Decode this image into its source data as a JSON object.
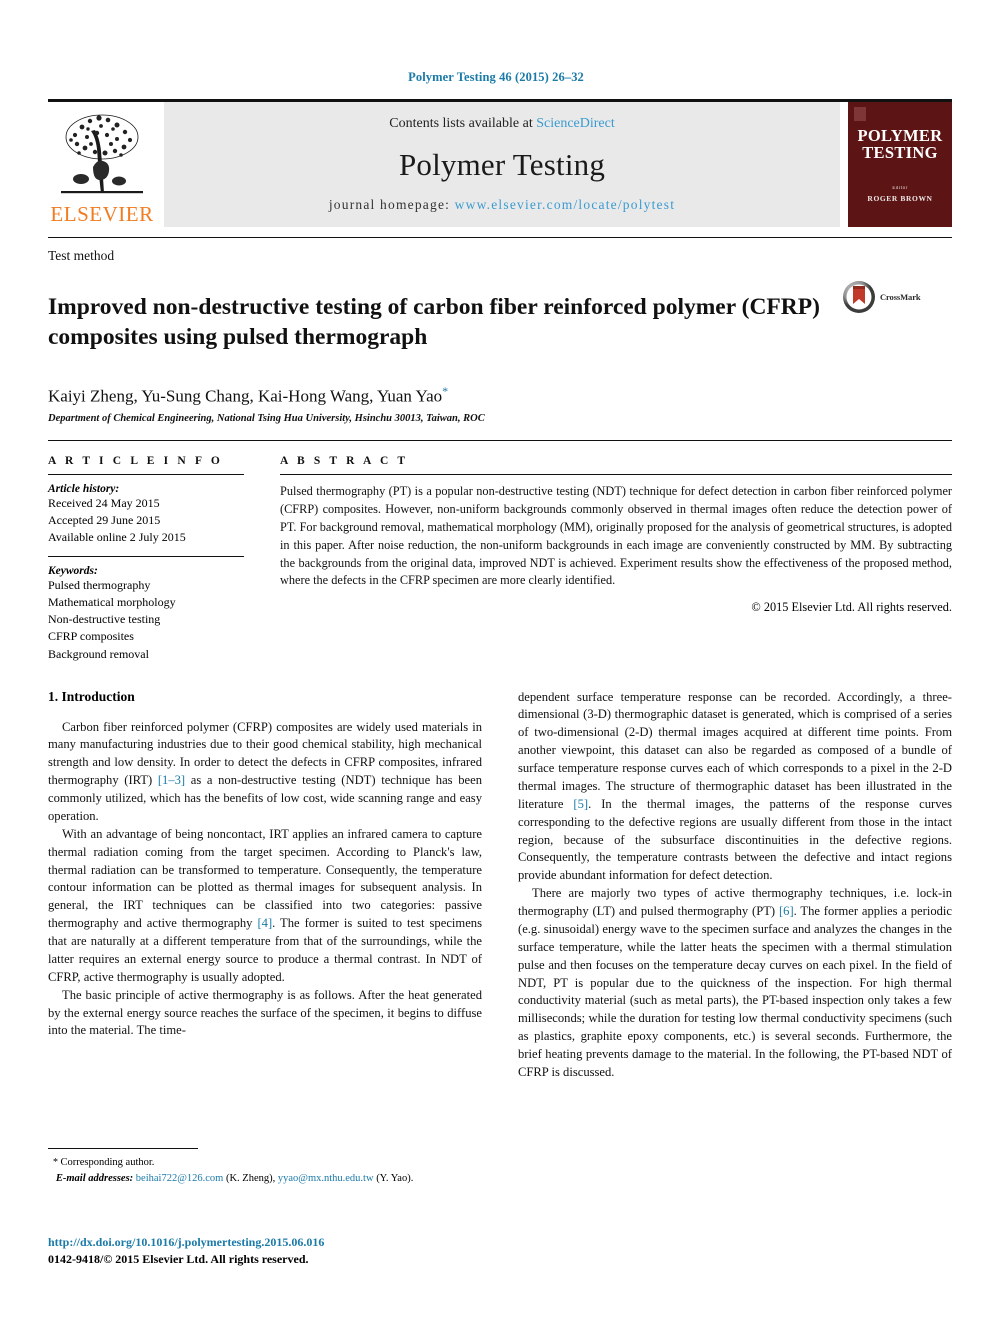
{
  "running_head": "Polymer Testing 46 (2015) 26–32",
  "masthead": {
    "publisher_logo_text": "ELSEVIER",
    "contents_prefix": "Contents lists available at ",
    "contents_link": "ScienceDirect",
    "journal_title": "Polymer Testing",
    "homepage_prefix": "journal homepage: ",
    "homepage_url": "www.elsevier.com/locate/polytest",
    "cover": {
      "title_line1": "POLYMER",
      "title_line2": "TESTING",
      "editor_label": "Editor",
      "editor_name": "ROGER BROWN"
    }
  },
  "article": {
    "section_kind": "Test method",
    "title": "Improved non-destructive testing of carbon fiber reinforced polymer (CFRP) composites using pulsed thermograph",
    "crossmark_label": "CrossMark",
    "authors": "Kaiyi Zheng, Yu-Sung Chang, Kai-Hong Wang, Yuan Yao",
    "corresponding_marker": "*",
    "affiliation": "Department of Chemical Engineering, National Tsing Hua University, Hsinchu 30013, Taiwan, ROC"
  },
  "article_info": {
    "label": "A R T I C L E   I N F O",
    "history_heading": "Article history:",
    "history": [
      "Received 24 May 2015",
      "Accepted 29 June 2015",
      "Available online 2 July 2015"
    ],
    "keywords_heading": "Keywords:",
    "keywords": [
      "Pulsed thermography",
      "Mathematical morphology",
      "Non-destructive testing",
      "CFRP composites",
      "Background removal"
    ]
  },
  "abstract": {
    "label": "A B S T R A C T",
    "text": "Pulsed thermography (PT) is a popular non-destructive testing (NDT) technique for defect detection in carbon fiber reinforced polymer (CFRP) composites. However, non-uniform backgrounds commonly observed in thermal images often reduce the detection power of PT. For background removal, mathematical morphology (MM), originally proposed for the analysis of geometrical structures, is adopted in this paper. After noise reduction, the non-uniform backgrounds in each image are conveniently constructed by MM. By subtracting the backgrounds from the original data, improved NDT is achieved. Experiment results show the effectiveness of the proposed method, where the defects in the CFRP specimen are more clearly identified.",
    "copyright": "© 2015 Elsevier Ltd. All rights reserved."
  },
  "body": {
    "heading": "1. Introduction",
    "left_p1_a": "Carbon fiber reinforced polymer (CFRP) composites are widely used materials in many manufacturing industries due to their good chemical stability, high mechanical strength and low density. In order to detect the defects in CFRP composites, infrared thermography (IRT) ",
    "left_p1_ref": "[1–3]",
    "left_p1_b": " as a non-destructive testing (NDT) technique has been commonly utilized, which has the benefits of low cost, wide scanning range and easy operation.",
    "left_p2_a": "With an advantage of being noncontact, IRT applies an infrared camera to capture thermal radiation coming from the target specimen. According to Planck's law, thermal radiation can be transformed to temperature. Consequently, the temperature contour information can be plotted as thermal images for subsequent analysis. In general, the IRT techniques can be classified into two categories: passive thermography and active thermography ",
    "left_p2_ref": "[4]",
    "left_p2_b": ". The former is suited to test specimens that are naturally at a different temperature from that of the surroundings, while the latter requires an external energy source to produce a thermal contrast. In NDT of CFRP, active thermography is usually adopted.",
    "left_p3": "The basic principle of active thermography is as follows. After the heat generated by the external energy source reaches the surface of the specimen, it begins to diffuse into the material. The time-",
    "right_p1_a": "dependent surface temperature response can be recorded. Accordingly, a three-dimensional (3-D) thermographic dataset is generated, which is comprised of a series of two-dimensional (2-D) thermal images acquired at different time points. From another viewpoint, this dataset can also be regarded as composed of a bundle of surface temperature response curves each of which corresponds to a pixel in the 2-D thermal images. The structure of thermographic dataset has been illustrated in the literature ",
    "right_p1_ref": "[5]",
    "right_p1_b": ". In the thermal images, the patterns of the response curves corresponding to the defective regions are usually different from those in the intact region, because of the subsurface discontinuities in the defective regions. Consequently, the temperature contrasts between the defective and intact regions provide abundant information for defect detection.",
    "right_p2_a": "There are majorly two types of active thermography techniques, i.e. lock-in thermography (LT) and pulsed thermography (PT) ",
    "right_p2_ref": "[6]",
    "right_p2_b": ". The former applies a periodic (e.g. sinusoidal) energy wave to the specimen surface and analyzes the changes in the surface temperature, while the latter heats the specimen with a thermal stimulation pulse and then focuses on the temperature decay curves on each pixel. In the field of NDT, PT is popular due to the quickness of the inspection. For high thermal conductivity material (such as metal parts), the PT-based inspection only takes a few milliseconds; while the duration for testing low thermal conductivity specimens (such as plastics, graphite epoxy components, etc.) is several seconds. Furthermore, the brief heating prevents damage to the material. In the following, the PT-based NDT of CFRP is discussed."
  },
  "footnote": {
    "corresponding": "Corresponding author.",
    "email_label": "E-mail addresses:",
    "email1": "beihai722@126.com",
    "email1_owner": "(K. Zheng)",
    "email2": "yyao@mx.nthu.edu.tw",
    "email2_owner": "(Y. Yao)."
  },
  "imprint": {
    "doi": "http://dx.doi.org/10.1016/j.polymertesting.2015.06.016",
    "issn": "0142-9418/© 2015 Elsevier Ltd. All rights reserved."
  },
  "colors": {
    "link": "#1a7aa8",
    "elsevier_orange": "#f07c23",
    "cover_maroon": "#5c1414",
    "band_gray": "#e9e9e9"
  }
}
